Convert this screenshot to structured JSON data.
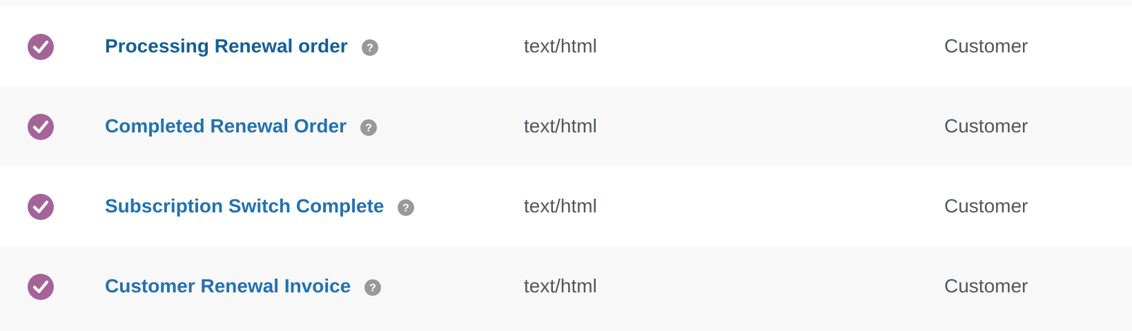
{
  "colors": {
    "status_enabled": "#a46497",
    "link": "#2271b1",
    "link_active": "#135e96",
    "help_icon": "#999999",
    "text": "#50575e",
    "row_odd": "#ffffff",
    "row_even": "#f8f8f8"
  },
  "icons": {
    "status": "check-circle-icon",
    "help": "question-mark-icon"
  },
  "emails": [
    {
      "enabled": true,
      "name": "Processing Renewal order",
      "content_type": "text/html",
      "recipient": "Customer"
    },
    {
      "enabled": true,
      "name": "Completed Renewal Order",
      "content_type": "text/html",
      "recipient": "Customer"
    },
    {
      "enabled": true,
      "name": "Subscription Switch Complete",
      "content_type": "text/html",
      "recipient": "Customer"
    },
    {
      "enabled": true,
      "name": "Customer Renewal Invoice",
      "content_type": "text/html",
      "recipient": "Customer"
    }
  ]
}
